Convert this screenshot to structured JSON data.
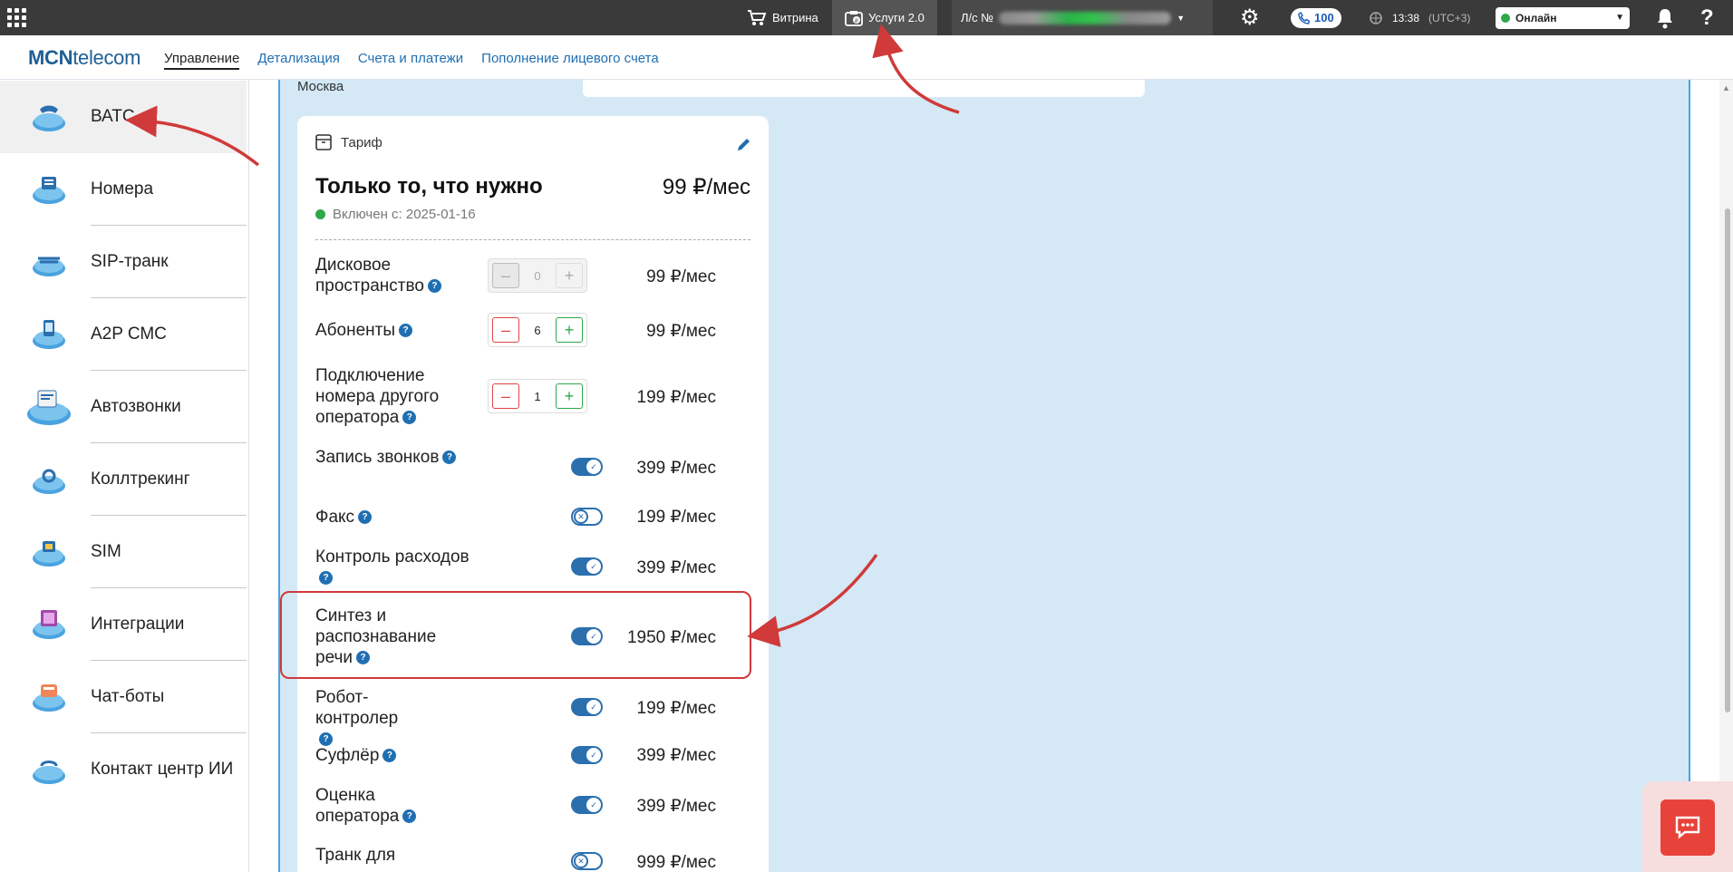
{
  "topbar": {
    "cart_label": "Витрина",
    "services_label": "Услуги 2.0",
    "account_prefix": "Л/с №",
    "calls_count": "100",
    "time": "13:38",
    "timezone": "(UTC+3)",
    "status": "Онлайн"
  },
  "brand": {
    "logo_bold": "MCN",
    "logo_rest": "telecom"
  },
  "nav": {
    "links": [
      "Управление",
      "Детализация",
      "Счета и платежи",
      "Пополнение лицевого счета"
    ],
    "active_index": 0
  },
  "sidebar": {
    "items": [
      {
        "label": "ВАТС",
        "icon": "phone-cloud-icon"
      },
      {
        "label": "Номера",
        "icon": "numbers-cloud-icon"
      },
      {
        "label": "SIP-транк",
        "icon": "sip-trunk-cloud-icon"
      },
      {
        "label": "A2P СМС",
        "icon": "sms-cloud-icon"
      },
      {
        "label": "Автозвонки",
        "icon": "autocall-cloud-icon"
      },
      {
        "label": "Коллтрекинг",
        "icon": "calltracking-cloud-icon"
      },
      {
        "label": "SIM",
        "icon": "sim-cloud-icon"
      },
      {
        "label": "Интеграции",
        "icon": "integrations-cloud-icon"
      },
      {
        "label": "Чат-боты",
        "icon": "chatbots-cloud-icon"
      },
      {
        "label": "Контакт центр ИИ",
        "icon": "ai-contact-center-cloud-icon"
      }
    ],
    "active_index": 0
  },
  "main": {
    "city": "Москва",
    "tariff": {
      "section_title": "Тариф",
      "plan_name": "Только то, что нужно",
      "plan_price": "99 ₽/мес",
      "enabled_since": "Включен с: 2025-01-16",
      "options": [
        {
          "label": "Дисковое пространство",
          "control": "stepper",
          "value": "0",
          "disabled": true,
          "price": "99 ₽/мес"
        },
        {
          "label": "Абоненты",
          "control": "stepper",
          "value": "6",
          "disabled": false,
          "price": "99 ₽/мес"
        },
        {
          "label": "Подключение номера другого оператора",
          "control": "stepper",
          "value": "1",
          "disabled": false,
          "price": "199 ₽/мес"
        },
        {
          "label": "Запись звонков",
          "control": "toggle",
          "on": true,
          "price": "399 ₽/мес"
        },
        {
          "label": "Факс",
          "control": "toggle",
          "on": false,
          "price": "199 ₽/мес"
        },
        {
          "label": "Контроль расходов",
          "control": "toggle",
          "on": true,
          "price": "399 ₽/мес"
        },
        {
          "label": "Синтез и распознавание речи",
          "control": "toggle",
          "on": true,
          "price": "1950 ₽/мес"
        },
        {
          "label": "Робот-контролер",
          "control": "toggle",
          "on": true,
          "price": "199 ₽/мес"
        },
        {
          "label": "Суфлёр",
          "control": "toggle",
          "on": true,
          "price": "399 ₽/мес"
        },
        {
          "label": "Оценка оператора",
          "control": "toggle",
          "on": true,
          "price": "399 ₽/мес"
        },
        {
          "label": "Транк для",
          "control": "toggle",
          "on": false,
          "price": "999 ₽/мес"
        }
      ]
    }
  },
  "colors": {
    "topbar": "#3a3a3a",
    "accent_blue": "#1f6fb2",
    "main_bg": "#d4e8f6",
    "annotation_red": "#d03a3a",
    "online_green": "#2ea84a"
  }
}
